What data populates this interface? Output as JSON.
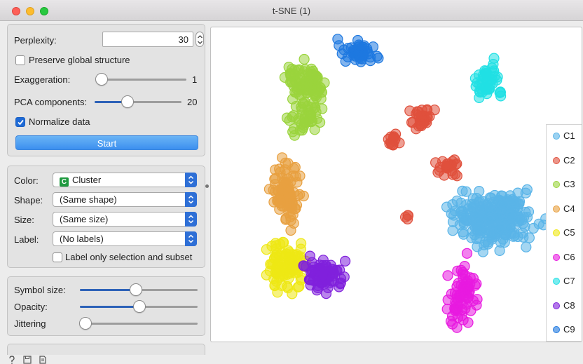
{
  "window": {
    "title": "t-SNE (1)"
  },
  "tsne": {
    "perplexity_label": "Perplexity:",
    "perplexity_value": "30",
    "preserve_label": "Preserve global structure",
    "preserve_checked": false,
    "exaggeration_label": "Exaggeration:",
    "exaggeration_value": "1",
    "exaggeration_level": 0.0,
    "pca_label": "PCA components:",
    "pca_value": "20",
    "pca_level": 0.35,
    "normalize_label": "Normalize data",
    "normalize_checked": true,
    "start_label": "Start"
  },
  "attrs": {
    "color_label": "Color:",
    "color_value": "Cluster",
    "color_value_icon": "C",
    "shape_label": "Shape:",
    "shape_value": "(Same shape)",
    "size_label": "Size:",
    "size_value": "(Same size)",
    "label_label": "Label:",
    "label_value": "(No labels)",
    "label_only_text": "Label only selection and subset",
    "label_only_checked": false
  },
  "symbols": {
    "symbol_size_label": "Symbol size:",
    "symbol_size_level": 0.48,
    "opacity_label": "Opacity:",
    "opacity_level": 0.5,
    "jittering_label": "Jittering",
    "jittering_level": 0.0
  },
  "legend": [
    {
      "name": "C1",
      "color": "#5ab4e8"
    },
    {
      "name": "C2",
      "color": "#e0503c"
    },
    {
      "name": "C3",
      "color": "#9ad43c"
    },
    {
      "name": "C4",
      "color": "#e8a040"
    },
    {
      "name": "C5",
      "color": "#eee814"
    },
    {
      "name": "C6",
      "color": "#e81ae0"
    },
    {
      "name": "C7",
      "color": "#20e0e4"
    },
    {
      "name": "C8",
      "color": "#8020dc"
    },
    {
      "name": "C9",
      "color": "#1e78e0"
    }
  ],
  "icons": [
    "help-icon",
    "save-icon",
    "report-icon"
  ]
}
